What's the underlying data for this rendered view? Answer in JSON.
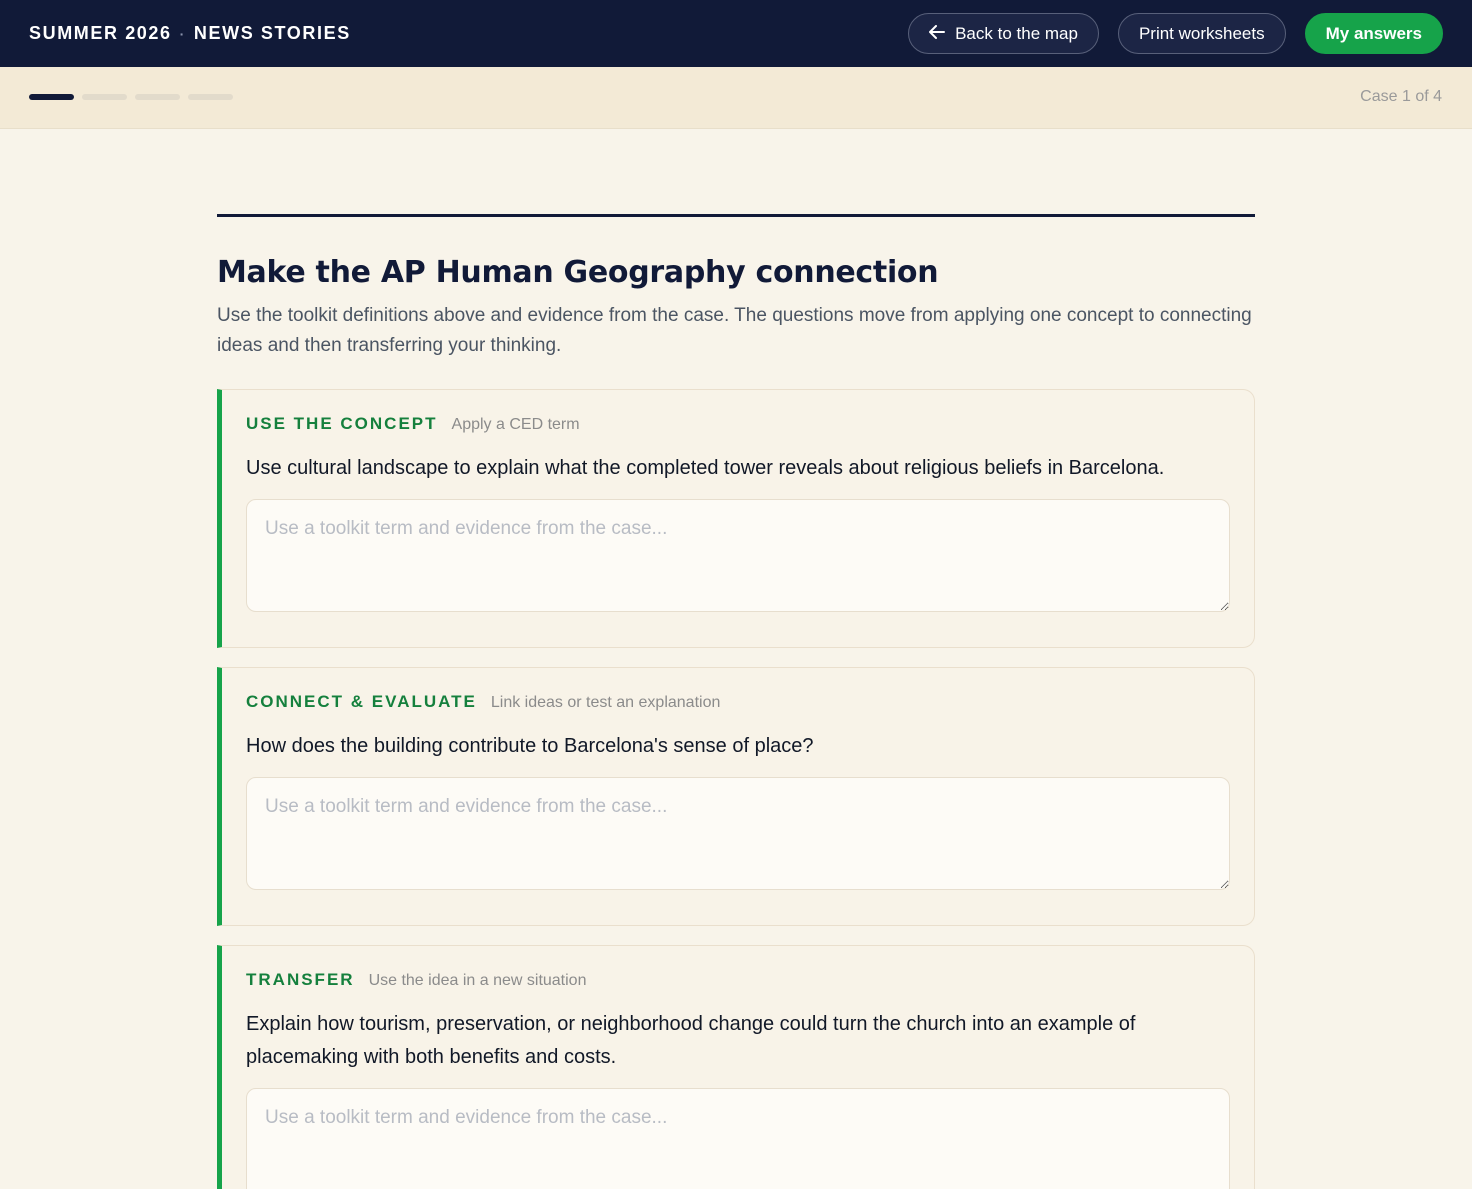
{
  "header": {
    "brand_part1": "SUMMER 2026",
    "brand_separator": "·",
    "brand_part2": "NEWS STORIES",
    "back_label": "Back to the map",
    "print_label": "Print worksheets",
    "answers_label": "My answers",
    "primary_color": "#16a34a",
    "nav_bg": "#111a38"
  },
  "progress": {
    "total_steps": 4,
    "current_step": 1,
    "case_label": "Case 1 of 4"
  },
  "section": {
    "title": "Make the AP Human Geography connection",
    "intro": "Use the toolkit definitions above and evidence from the case. The questions move from applying one concept to connecting ideas and then transferring your thinking."
  },
  "questions": [
    {
      "kind": "USE THE CONCEPT",
      "subtitle": "Apply a CED term",
      "prompt": "Use cultural landscape to explain what the completed tower reveals about religious beliefs in Barcelona.",
      "placeholder": "Use a toolkit term and evidence from the case...",
      "value": ""
    },
    {
      "kind": "CONNECT & EVALUATE",
      "subtitle": "Link ideas or test an explanation",
      "prompt": "How does the building contribute to Barcelona's sense of place?",
      "placeholder": "Use a toolkit term and evidence from the case...",
      "value": ""
    },
    {
      "kind": "TRANSFER",
      "subtitle": "Use the idea in a new situation",
      "prompt": "Explain how tourism, preservation, or neighborhood change could turn the church into an example of placemaking with both benefits and costs.",
      "placeholder": "Use a toolkit term and evidence from the case...",
      "value": ""
    }
  ]
}
